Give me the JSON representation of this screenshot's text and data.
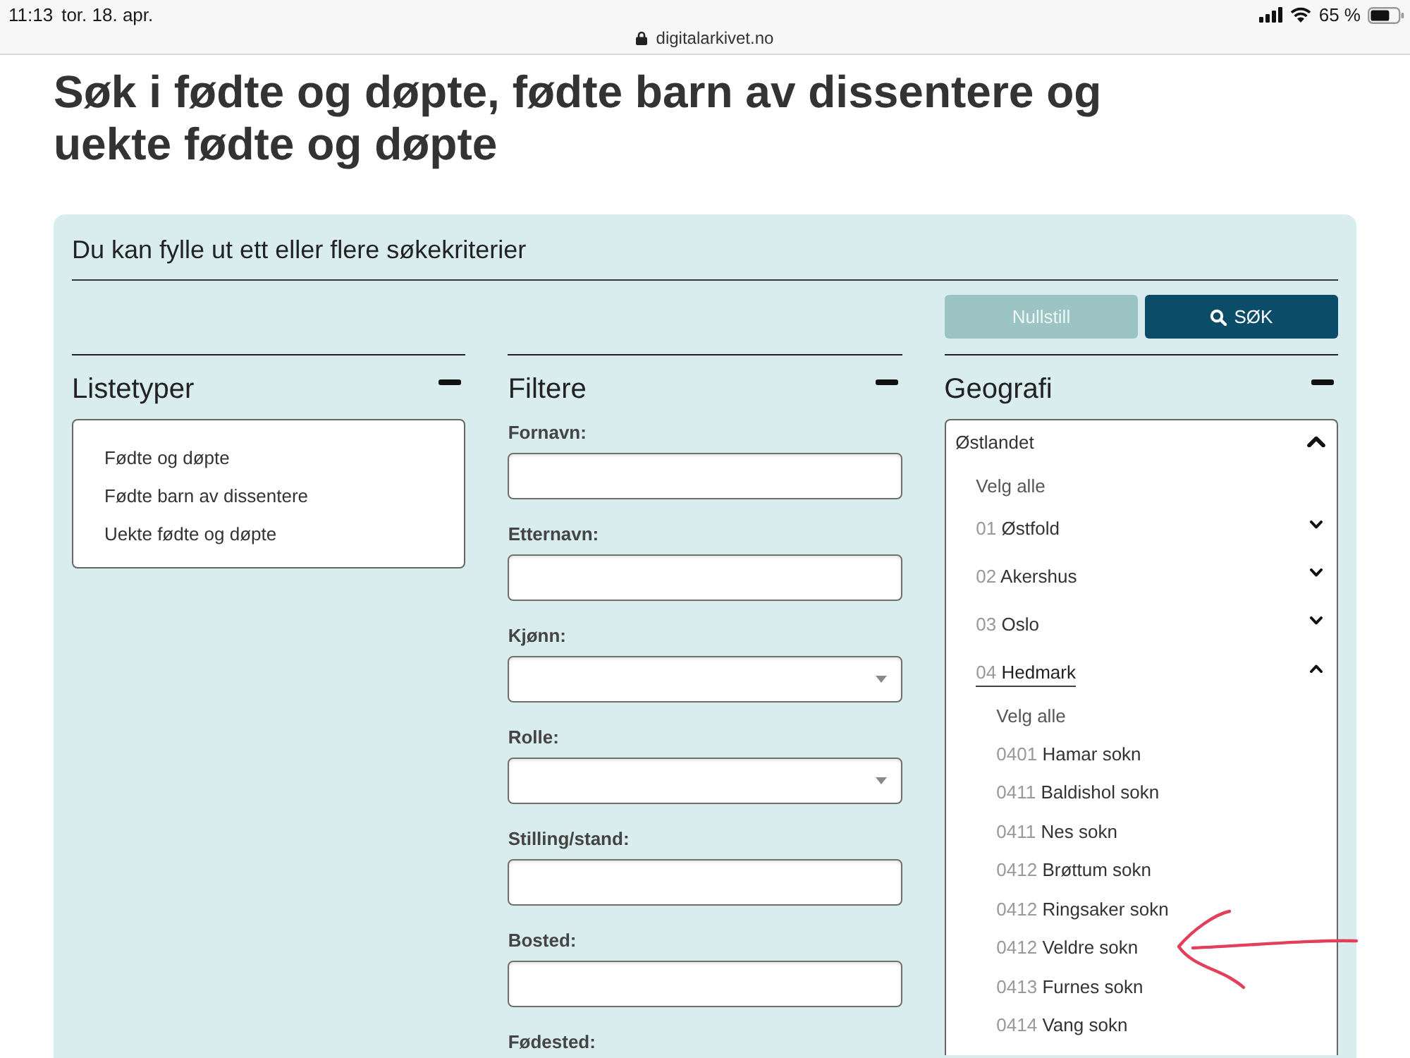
{
  "status_bar": {
    "time": "11:13",
    "date": "tor. 18. apr.",
    "url": "digitalarkivet.no",
    "battery": "65 %"
  },
  "title": "Søk i fødte og døpte, fødte barn av dissentere og uekte fødte og døpte",
  "search_panel": {
    "intro": "Du kan fylle ut ett eller flere søkekriterier",
    "buttons": [
      {
        "label": "Nullstill",
        "kind": "reset",
        "disabled": true
      },
      {
        "label": "SØK",
        "kind": "search",
        "disabled": false
      }
    ],
    "sections": [
      {
        "kind": "list",
        "title": "Listetyper",
        "expanded": true,
        "items": [
          "Fødte og døpte",
          "Fødte barn av dissentere",
          "Uekte fødte og døpte"
        ]
      },
      {
        "kind": "filters",
        "title": "Filtere",
        "expanded": true,
        "fields": [
          {
            "label": "Fornavn:",
            "kind": "text"
          },
          {
            "label": "Etternavn:",
            "kind": "text"
          },
          {
            "label": "Kjønn:",
            "kind": "select"
          },
          {
            "label": "Rolle:",
            "kind": "select"
          },
          {
            "label": "Stilling/stand:",
            "kind": "text"
          },
          {
            "label": "Bosted:",
            "kind": "text"
          },
          {
            "label": "Fødested:"
          }
        ]
      },
      {
        "kind": "tree",
        "title": "Geografi",
        "expanded": true,
        "tree": [
          {
            "kind": "region",
            "label": "Østlandet",
            "expanded": true,
            "children": [
              {
                "kind": "select_all",
                "label": "Velg alle"
              },
              {
                "kind": "county",
                "code": "01",
                "label": "Østfold",
                "expanded": false,
                "selected": false
              },
              {
                "kind": "county",
                "code": "02",
                "label": "Akershus",
                "expanded": false,
                "selected": false
              },
              {
                "kind": "county",
                "code": "03",
                "label": "Oslo",
                "expanded": false,
                "selected": false
              },
              {
                "kind": "county",
                "code": "04",
                "label": "Hedmark",
                "expanded": true,
                "selected": true,
                "children": [
                  {
                    "kind": "select_all",
                    "label": "Velg alle",
                    "marked": false
                  },
                  {
                    "kind": "parish",
                    "code": "0401",
                    "label": "Hamar sokn",
                    "marked": false
                  },
                  {
                    "kind": "parish",
                    "code": "0411",
                    "label": "Baldishol sokn",
                    "marked": false
                  },
                  {
                    "kind": "parish",
                    "code": "0411",
                    "label": "Nes sokn",
                    "marked": false
                  },
                  {
                    "kind": "parish",
                    "code": "0412",
                    "label": "Brøttum sokn",
                    "marked": false
                  },
                  {
                    "kind": "parish",
                    "code": "0412",
                    "label": "Ringsaker sokn",
                    "marked": false
                  },
                  {
                    "kind": "parish",
                    "code": "0412",
                    "label": "Veldre sokn",
                    "marked": true
                  },
                  {
                    "kind": "parish",
                    "code": "0413",
                    "label": "Furnes sokn",
                    "marked": false
                  },
                  {
                    "kind": "parish",
                    "code": "0414",
                    "label": "Vang sokn",
                    "marked": false
                  }
                ]
              }
            ]
          }
        ]
      }
    ]
  }
}
